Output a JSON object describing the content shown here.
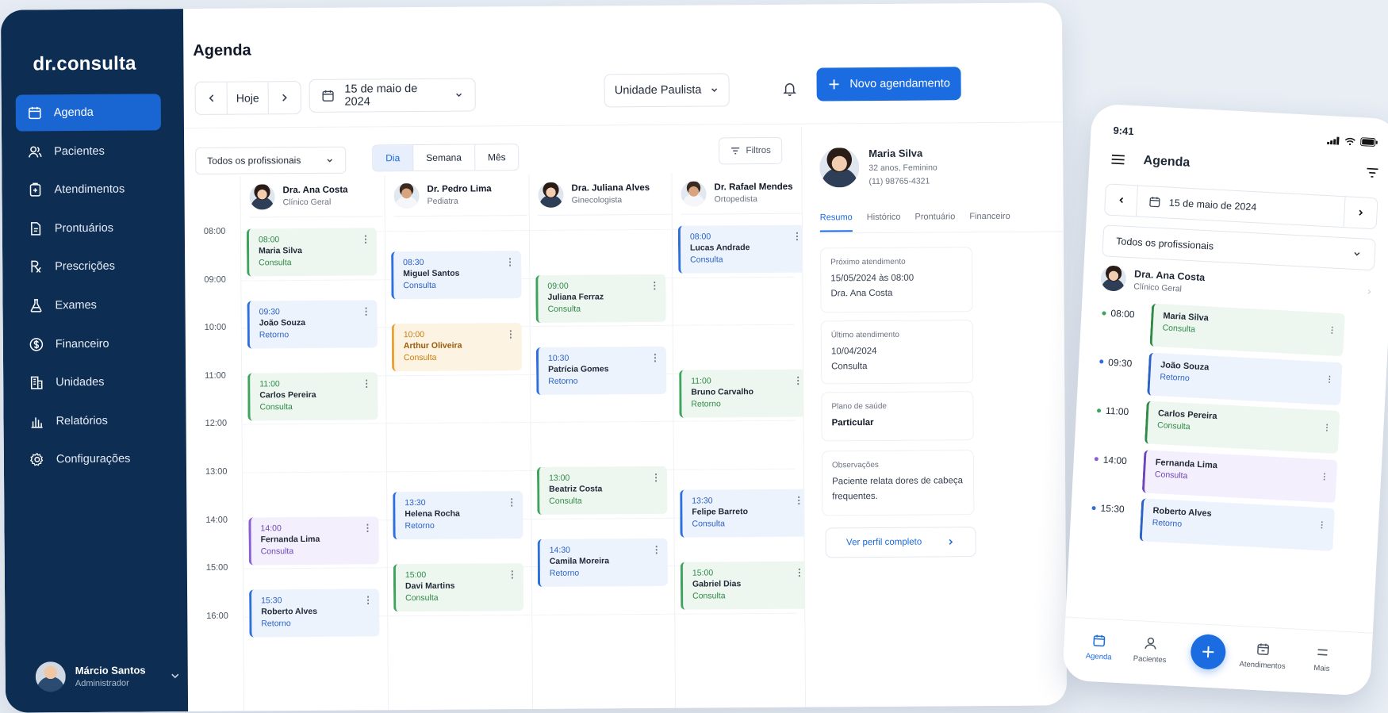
{
  "app": {
    "logo": "dr.consulta"
  },
  "sidebar": {
    "items": [
      {
        "label": "Agenda",
        "icon": "calendar-icon",
        "active": true
      },
      {
        "label": "Pacientes",
        "icon": "users-icon"
      },
      {
        "label": "Atendimentos",
        "icon": "clipboard-icon"
      },
      {
        "label": "Prontuários",
        "icon": "document-icon"
      },
      {
        "label": "Prescrições",
        "icon": "rx-icon"
      },
      {
        "label": "Exames",
        "icon": "flask-icon"
      },
      {
        "label": "Financeiro",
        "icon": "dollar-icon"
      },
      {
        "label": "Unidades",
        "icon": "building-icon"
      },
      {
        "label": "Relatórios",
        "icon": "bar-chart-icon"
      },
      {
        "label": "Configurações",
        "icon": "gear-icon"
      }
    ],
    "user": {
      "name": "Márcio Santos",
      "role": "Administrador"
    }
  },
  "header": {
    "title": "Agenda",
    "today": "Hoje",
    "date": "15 de maio de 2024",
    "unit": "Unidade Paulista",
    "new_button": "Novo agendamento"
  },
  "toolbar": {
    "professional_filter": "Todos os profissionais",
    "views": [
      "Dia",
      "Semana",
      "Mês"
    ],
    "active_view": "Dia",
    "filters": "Filtros"
  },
  "calendar": {
    "times": [
      "08:00",
      "09:00",
      "10:00",
      "11:00",
      "12:00",
      "13:00",
      "14:00",
      "15:00",
      "16:00"
    ],
    "doctors": [
      {
        "name": "Dra. Ana Costa",
        "specialty": "Clínico Geral",
        "appointments": [
          {
            "time": "08:00",
            "patient": "Maria Silva",
            "type": "Consulta",
            "color": "green"
          },
          {
            "time": "09:30",
            "patient": "João Souza",
            "type": "Retorno",
            "color": "blue"
          },
          {
            "time": "11:00",
            "patient": "Carlos Pereira",
            "type": "Consulta",
            "color": "green"
          },
          {
            "time": "14:00",
            "patient": "Fernanda Lima",
            "type": "Consulta",
            "color": "purple"
          },
          {
            "time": "15:30",
            "patient": "Roberto Alves",
            "type": "Retorno",
            "color": "blue"
          }
        ]
      },
      {
        "name": "Dr. Pedro Lima",
        "specialty": "Pediatra",
        "appointments": [
          {
            "time": "08:30",
            "patient": "Miguel Santos",
            "type": "Consulta",
            "color": "blue"
          },
          {
            "time": "10:00",
            "patient": "Arthur Oliveira",
            "type": "Consulta",
            "color": "orange"
          },
          {
            "time": "13:30",
            "patient": "Helena Rocha",
            "type": "Retorno",
            "color": "blue"
          },
          {
            "time": "15:00",
            "patient": "Davi Martins",
            "type": "Consulta",
            "color": "green"
          }
        ]
      },
      {
        "name": "Dra. Juliana Alves",
        "specialty": "Ginecologista",
        "appointments": [
          {
            "time": "09:00",
            "patient": "Juliana Ferraz",
            "type": "Consulta",
            "color": "green"
          },
          {
            "time": "10:30",
            "patient": "Patrícia Gomes",
            "type": "Retorno",
            "color": "blue"
          },
          {
            "time": "13:00",
            "patient": "Beatriz Costa",
            "type": "Consulta",
            "color": "green"
          },
          {
            "time": "14:30",
            "patient": "Camila Moreira",
            "type": "Retorno",
            "color": "blue"
          }
        ]
      },
      {
        "name": "Dr. Rafael Mendes",
        "specialty": "Ortopedista",
        "appointments": [
          {
            "time": "08:00",
            "patient": "Lucas Andrade",
            "type": "Consulta",
            "color": "blue"
          },
          {
            "time": "11:00",
            "patient": "Bruno Carvalho",
            "type": "Retorno",
            "color": "green"
          },
          {
            "time": "13:30",
            "patient": "Felipe Barreto",
            "type": "Consulta",
            "color": "blue"
          },
          {
            "time": "15:00",
            "patient": "Gabriel Dias",
            "type": "Consulta",
            "color": "green"
          }
        ]
      }
    ]
  },
  "patient_panel": {
    "name": "Maria Silva",
    "info": "32 anos, Feminino",
    "phone": "(11) 98765-4321",
    "tabs": [
      "Resumo",
      "Histórico",
      "Prontuário",
      "Financeiro"
    ],
    "next_label": "Próximo atendimento",
    "next_date": "15/05/2024 às 08:00",
    "next_doctor": "Dra. Ana Costa",
    "last_label": "Último atendimento",
    "last_date": "10/04/2024",
    "last_type": "Consulta",
    "plan_label": "Plano de saúde",
    "plan": "Particular",
    "obs_label": "Observações",
    "obs": "Paciente relata dores de cabeça frequentes.",
    "full_profile": "Ver perfil completo"
  },
  "mobile": {
    "time": "9:41",
    "title": "Agenda",
    "date": "15 de maio de 2024",
    "professional_filter": "Todos os profissionais",
    "doctor": {
      "name": "Dra. Ana Costa",
      "specialty": "Clínico Geral"
    },
    "appointments": [
      {
        "time": "08:00",
        "patient": "Maria Silva",
        "type": "Consulta",
        "color": "green"
      },
      {
        "time": "09:30",
        "patient": "João Souza",
        "type": "Retorno",
        "color": "blue"
      },
      {
        "time": "11:00",
        "patient": "Carlos Pereira",
        "type": "Consulta",
        "color": "green"
      },
      {
        "time": "14:00",
        "patient": "Fernanda Lima",
        "type": "Consulta",
        "color": "purple"
      },
      {
        "time": "15:30",
        "patient": "Roberto Alves",
        "type": "Retorno",
        "color": "blue"
      }
    ],
    "tabbar": [
      "Agenda",
      "Pacientes",
      "Atendimentos",
      "Mais"
    ]
  },
  "colors": {
    "accent": "#1a6ce0",
    "sidebar": "#0d2d52",
    "green": "#3da35d",
    "blue": "#2d6fde",
    "orange": "#e8a23a",
    "purple": "#8a5cd6"
  }
}
